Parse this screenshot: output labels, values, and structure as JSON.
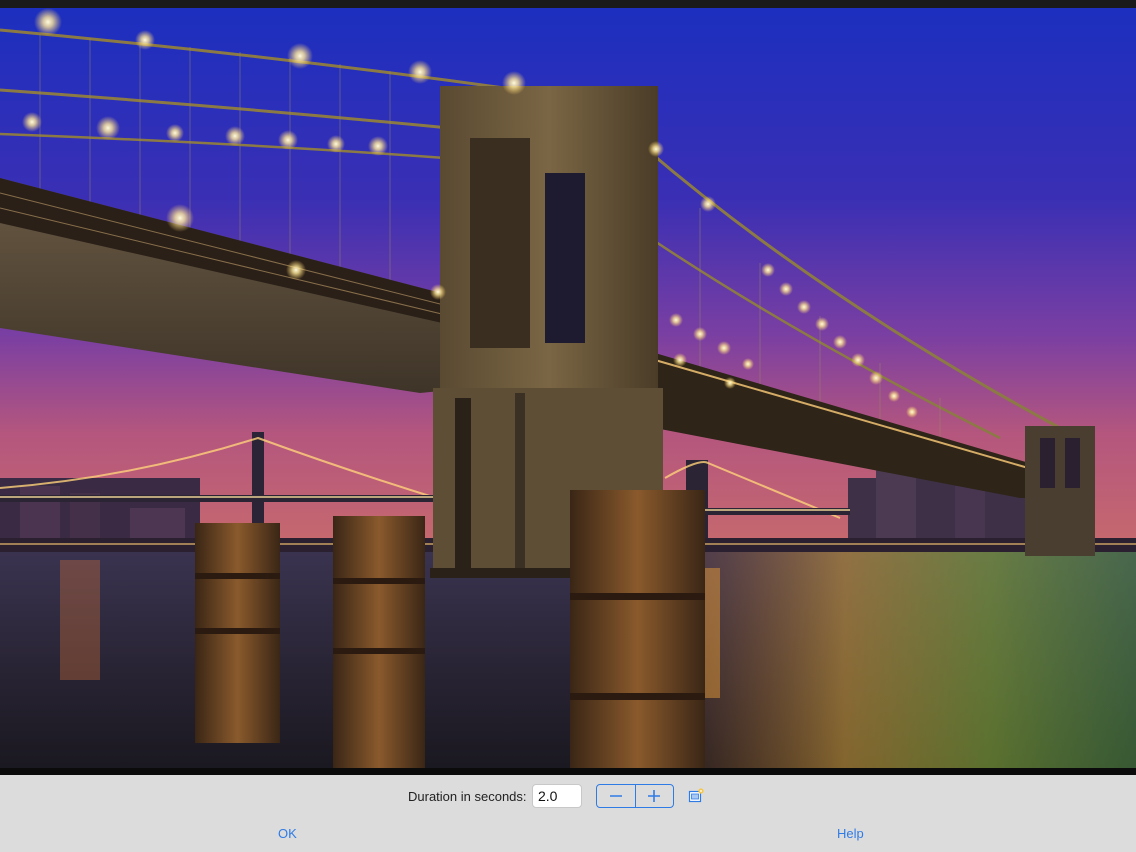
{
  "photo": {
    "subject": "bridge-at-night-photo"
  },
  "controls": {
    "duration_label": "Duration in seconds:",
    "duration_value": "2.0",
    "decrement_icon": "minus-icon",
    "increment_icon": "plus-icon",
    "extra_icon": "slideshow-icon"
  },
  "footer": {
    "ok_label": "OK",
    "help_label": "Help"
  },
  "colors": {
    "accent": "#2f7be6",
    "panel_bg": "#dcdcdc"
  }
}
